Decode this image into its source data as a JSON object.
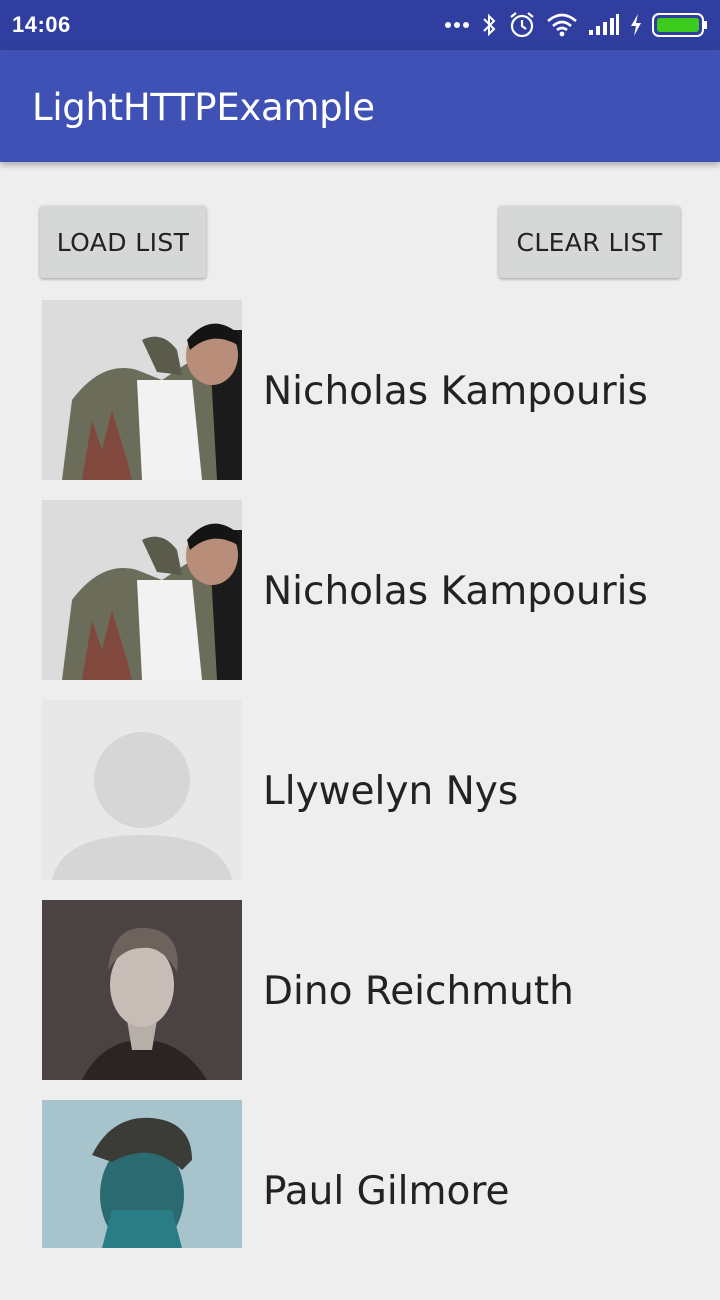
{
  "status_bar": {
    "time": "14:06",
    "icons": [
      "more-dots-icon",
      "bluetooth-icon",
      "alarm-icon",
      "wifi-icon",
      "signal-icon",
      "charging-icon",
      "battery-icon"
    ],
    "battery_color": "#3ccc1e"
  },
  "app_bar": {
    "title": "LightHTTPExample",
    "color": "#3f51b5",
    "status_color": "#303f9f"
  },
  "buttons": {
    "load_label": "LOAD LIST",
    "clear_label": "CLEAR LIST"
  },
  "list": {
    "items": [
      {
        "name": "Nicholas Kampouris",
        "avatar": "photo-man-camo-jacket"
      },
      {
        "name": "Nicholas Kampouris",
        "avatar": "photo-man-camo-jacket"
      },
      {
        "name": "Llywelyn Nys",
        "avatar": "default-avatar-placeholder"
      },
      {
        "name": "Dino Reichmuth",
        "avatar": "photo-man-dark-background"
      },
      {
        "name": "Paul Gilmore",
        "avatar": "photo-man-teal-background"
      }
    ]
  }
}
